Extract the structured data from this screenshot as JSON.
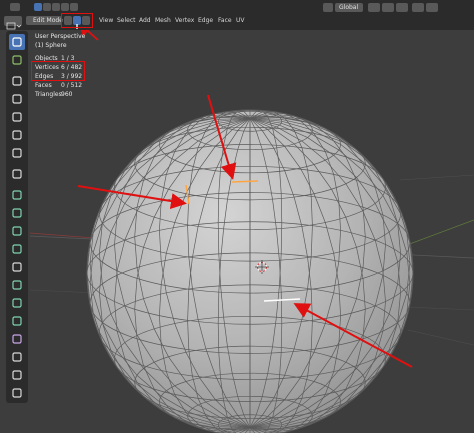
{
  "header": {
    "mode_label": "Edit Mode",
    "menus": [
      "View",
      "Select",
      "Add",
      "Mesh",
      "Vertex",
      "Edge",
      "Face",
      "UV"
    ],
    "transform_orientation": "Global",
    "select_modes": [
      "vertex-select",
      "edge-select",
      "face-select"
    ],
    "active_select_mode": "edge-select"
  },
  "overlay": {
    "view_name": "User Perspective",
    "object_name": "(1) Sphere",
    "stats": [
      {
        "label": "Objects",
        "value": "1 / 3"
      },
      {
        "label": "Vertices",
        "value": "6 / 482"
      },
      {
        "label": "Edges",
        "value": "3 / 992"
      },
      {
        "label": "Faces",
        "value": "0 / 512"
      },
      {
        "label": "Triangles",
        "value": "960"
      }
    ]
  },
  "toolbar": {
    "tools": [
      "select-box-icon",
      "cursor-icon",
      "move-icon",
      "rotate-icon",
      "scale-icon",
      "transform-icon",
      "annotate-icon",
      "measure-icon",
      "extrude-icon",
      "inset-icon",
      "bevel-icon",
      "loop-cut-icon",
      "knife-icon",
      "poly-build-icon",
      "spin-icon",
      "smooth-icon",
      "edge-slide-icon",
      "shrink-fatten-icon",
      "shear-icon",
      "rip-icon"
    ]
  },
  "colors": {
    "viewport_bg": "#3d3d3d",
    "header_bg": "#2b2b2b",
    "accent": "#4772b3",
    "selection": "#ffa640",
    "annotation": "#e01010",
    "mesh": "#b7b7b7"
  }
}
